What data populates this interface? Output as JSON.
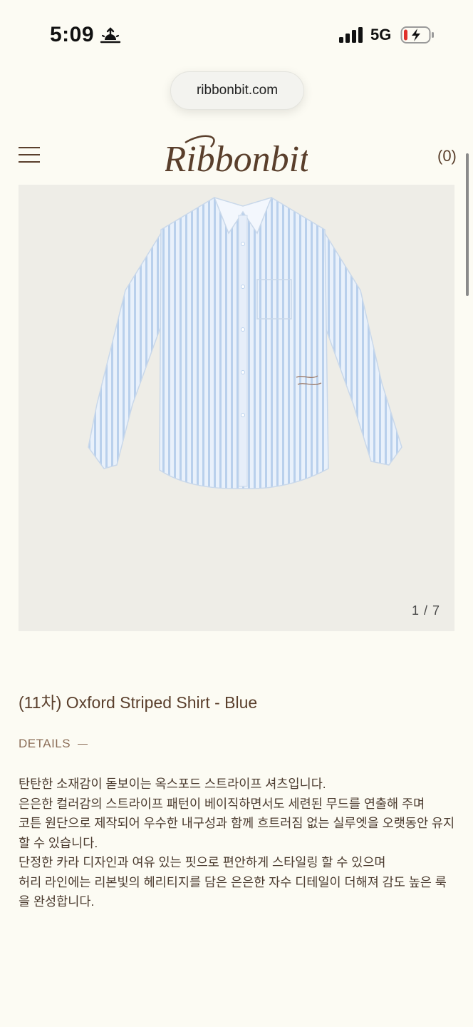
{
  "status_bar": {
    "time": "5:09",
    "network": "5G"
  },
  "browser": {
    "url": "ribbonbit.com"
  },
  "header": {
    "logo_text": "Ribbonbit",
    "cart": "(0)"
  },
  "product": {
    "image_counter": "1 / 7",
    "title": "(11차) Oxford Striped Shirt - Blue",
    "details_label": "DETAILS",
    "description_lines": [
      "탄탄한 소재감이 돋보이는 옥스포드 스트라이프 셔츠입니다.",
      "은은한 컬러감의 스트라이프 패턴이 베이직하면서도 세련된 무드를 연출해 주며",
      "코튼 원단으로 제작되어 우수한 내구성과 함께 흐트러짐 없는 실루엣을 오랫동안 유지할 수 있습니다.",
      "단정한 카라 디자인과 여유 있는 핏으로 편안하게 스타일링 할 수 있으며",
      "허리 라인에는 리본빛의 헤리티지를 담은 은은한 자수 디테일이 더해져 감도 높은 룩을 완성합니다."
    ]
  },
  "colors": {
    "background": "#fcfbf3",
    "brand_brown": "#5a3f2c",
    "image_bg": "#eeede7",
    "shirt_blue": "#bcd3ee"
  }
}
